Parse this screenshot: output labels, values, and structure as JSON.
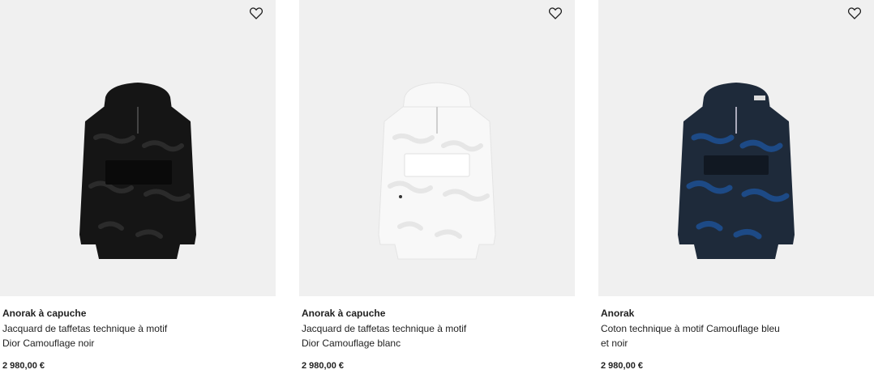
{
  "products": [
    {
      "name": "Anorak à capuche",
      "description_line1": "Jacquard de taffetas technique à motif",
      "description_line2": "Dior Camouflage noir",
      "price": "2 980,00 €",
      "image_icon": "black-camouflage-anorak",
      "colors": {
        "body": "#151515",
        "camo": "#2b2b2b",
        "trim": "#0a0a0a"
      }
    },
    {
      "name": "Anorak à capuche",
      "description_line1": "Jacquard de taffetas technique à motif",
      "description_line2": "Dior Camouflage blanc",
      "price": "2 980,00 €",
      "image_icon": "white-camouflage-anorak",
      "colors": {
        "body": "#f8f8f8",
        "camo": "#e6e6e6",
        "trim": "#dcdcdc"
      }
    },
    {
      "name": "Anorak",
      "description_line1": "Coton technique à motif Camouflage bleu",
      "description_line2": "et noir",
      "price": "2 980,00 €",
      "image_icon": "blue-black-camouflage-anorak",
      "colors": {
        "body": "#1e2a3a",
        "camo": "#1d4a86",
        "trim": "#111822"
      }
    }
  ],
  "wishlist_icon": "heart-outline-icon"
}
